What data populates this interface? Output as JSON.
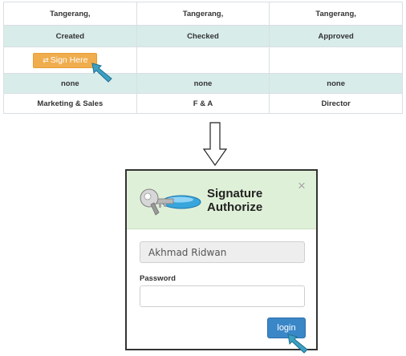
{
  "signature_table": {
    "columns": [
      {
        "city": "Tangerang,",
        "role": "Created",
        "status": "none",
        "department": "Marketing & Sales"
      },
      {
        "city": "Tangerang,",
        "role": "Checked",
        "status": "none",
        "department": "F & A"
      },
      {
        "city": "Tangerang,",
        "role": "Approved",
        "status": "none",
        "department": "Director"
      }
    ],
    "sign_button": {
      "icon": "refresh-icon",
      "label": "Sign Here"
    }
  },
  "modal": {
    "title_line1": "Signature",
    "title_line2": "Authorize",
    "close": "×",
    "icon": "key-icon",
    "username_value": "Akhmad Ridwan",
    "password_label": "Password",
    "password_value": "",
    "login_label": "login"
  },
  "colors": {
    "sign_button": "#f0ad4e",
    "login_button": "#3a87c8",
    "stripe": "#d8ecea",
    "modal_header": "#dff0d8",
    "cursor": "#3ca0c3"
  }
}
